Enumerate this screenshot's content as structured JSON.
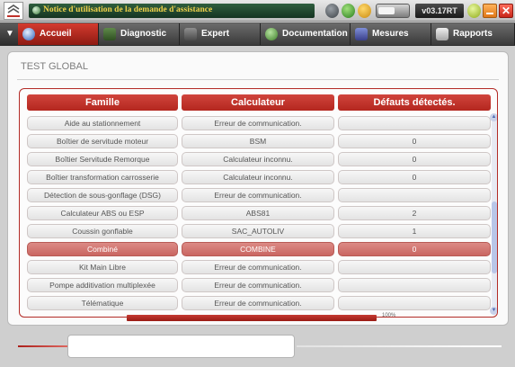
{
  "window": {
    "title": "Notice d'utilisation de la demande d'assistance",
    "version": "v03.17RT",
    "close_symbol": "✕",
    "toolbar_progress": 0.55
  },
  "nav": {
    "tabs": [
      {
        "label": "Accueil",
        "icon": "home-icon",
        "active": true
      },
      {
        "label": "Diagnostic",
        "icon": "diagnostic-icon"
      },
      {
        "label": "Expert",
        "icon": "expert-icon"
      },
      {
        "label": "Documentation",
        "icon": "documentation-icon"
      },
      {
        "label": "Mesures",
        "icon": "measures-icon"
      },
      {
        "label": "Rapports",
        "icon": "reports-icon"
      }
    ]
  },
  "main": {
    "title": "TEST GLOBAL",
    "table": {
      "headers": [
        "Famille",
        "Calculateur",
        "Défauts détectés."
      ],
      "rows": [
        {
          "famille": "Aide au stationnement",
          "calculateur": "Erreur de communication.",
          "defauts": ""
        },
        {
          "famille": "Boîtier de servitude moteur",
          "calculateur": "BSM",
          "defauts": "0"
        },
        {
          "famille": "Boîtier Servitude Remorque",
          "calculateur": "Calculateur inconnu.",
          "defauts": "0"
        },
        {
          "famille": "Boîtier transformation carrosserie",
          "calculateur": "Calculateur inconnu.",
          "defauts": "0"
        },
        {
          "famille": "Détection de sous-gonflage (DSG)",
          "calculateur": "Erreur de communication.",
          "defauts": ""
        },
        {
          "famille": "Calculateur ABS ou ESP",
          "calculateur": "ABS81",
          "defauts": "2"
        },
        {
          "famille": "Coussin gonflable",
          "calculateur": "SAC_AUTOLIV",
          "defauts": "1"
        },
        {
          "famille": "Combiné",
          "calculateur": "COMBINE",
          "defauts": "0",
          "highlight": true
        },
        {
          "famille": "Kit Main Libre",
          "calculateur": "Erreur de communication.",
          "defauts": ""
        },
        {
          "famille": "Pompe additivation multiplexée",
          "calculateur": "Erreur de communication.",
          "defauts": ""
        },
        {
          "famille": "Télématique",
          "calculateur": "Erreur de communication.",
          "defauts": ""
        }
      ]
    },
    "progress": {
      "value": 1.0,
      "label": "100%"
    }
  },
  "bottom": {
    "input_value": ""
  },
  "colors": {
    "accent": "#c0322b",
    "title_text": "#f0d24a",
    "highlight_row": "#d17a75"
  }
}
